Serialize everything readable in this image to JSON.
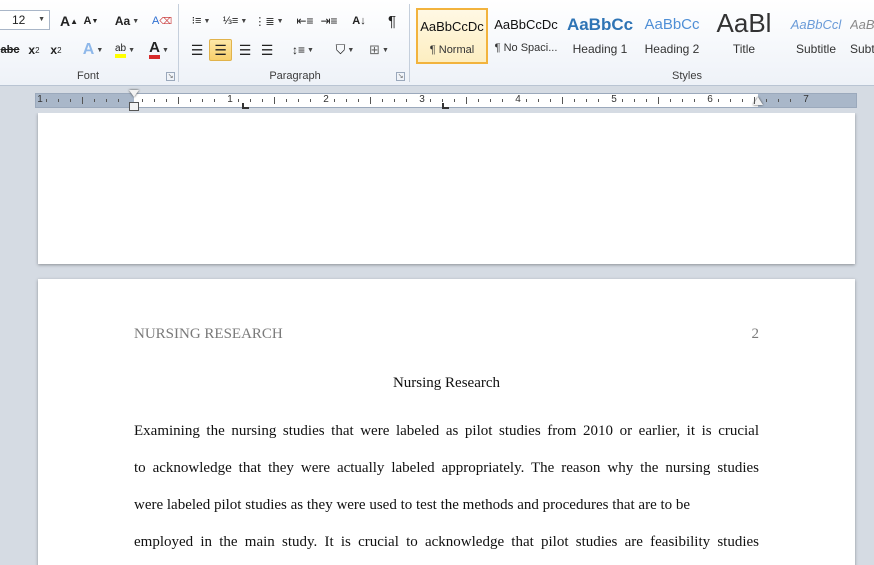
{
  "ribbon": {
    "font_size_value": "12",
    "groups": {
      "font": "Font",
      "paragraph": "Paragraph",
      "styles": "Styles"
    },
    "font_buttons": {
      "grow": "A",
      "shrink": "A",
      "change_case": "Aa",
      "strikethrough": "abc",
      "subscript": "x",
      "superscript": "x",
      "text_effects": "A",
      "highlight": "ab",
      "font_color": "A"
    },
    "paragraph_buttons": {
      "sort": "A↓",
      "show_marks": "¶"
    }
  },
  "styles_gallery": [
    {
      "sample": "AaBbCcDc",
      "name": "¶ Normal",
      "selected": true
    },
    {
      "sample": "AaBbCcDc",
      "name": "¶ No Spaci...",
      "selected": false
    },
    {
      "sample": "AaBbCc",
      "name": "Heading 1",
      "selected": false
    },
    {
      "sample": "AaBbCc",
      "name": "Heading 2",
      "selected": false
    },
    {
      "sample": "AaBl",
      "name": "Title",
      "selected": false
    },
    {
      "sample": "AaBbCcl",
      "name": "Subtitle",
      "selected": false
    },
    {
      "sample": "AaBbCcl",
      "name": "Subt",
      "selected": false
    }
  ],
  "ruler": {
    "numbers": [
      "1",
      "1",
      "2",
      "3",
      "4",
      "5",
      "6",
      "7"
    ]
  },
  "document": {
    "running_head": "NURSING RESEARCH",
    "page_number": "2",
    "title": "Nursing Research",
    "lines": [
      "Examining the nursing studies that were labeled as pilot studies from 2010 or earlier, it is crucial",
      "to acknowledge that they were actually labeled appropriately. The reason why the nursing studies",
      "were labeled pilot studies as they were used to test the methods and procedures that are to be",
      "employed in the main study. It is crucial to acknowledge that pilot studies are feasibility studies"
    ]
  },
  "colors": {
    "accent_selected": "#f2b33d",
    "heading_blue": "#2e74b5",
    "font_color_red": "#d62a2a",
    "highlight_yellow": "#ffff00"
  }
}
